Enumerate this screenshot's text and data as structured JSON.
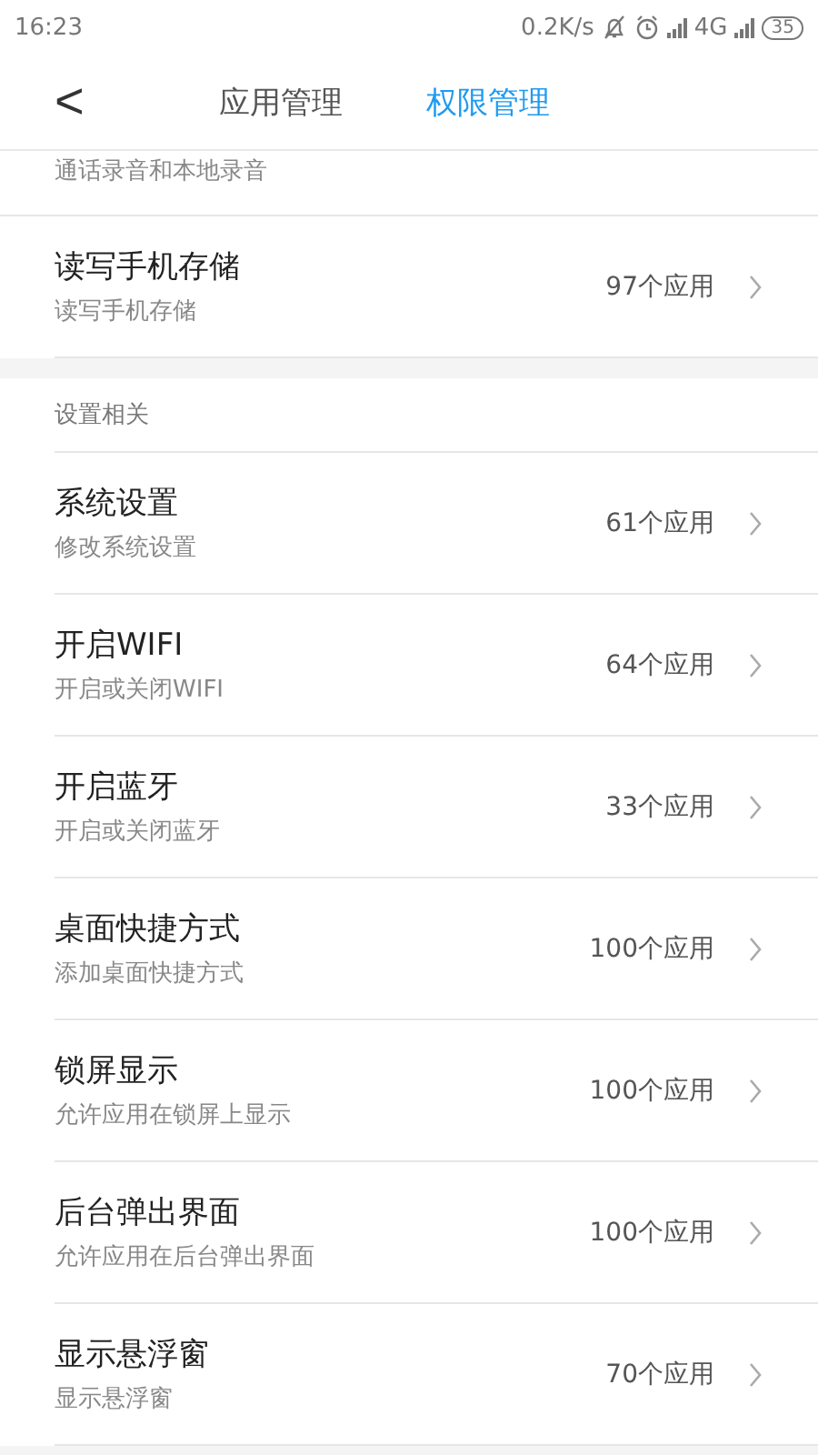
{
  "status_bar": {
    "time": "16:23",
    "speed": "0.2K/s",
    "network": "4G",
    "battery": "35"
  },
  "header": {
    "back": "<",
    "tabs": [
      {
        "label": "应用管理",
        "selected": false
      },
      {
        "label": "权限管理",
        "selected": true
      }
    ]
  },
  "partial_row": {
    "subtitle": "通话录音和本地录音"
  },
  "rows": [
    {
      "title": "读写手机存储",
      "subtitle": "读写手机存储",
      "count": "97个应用"
    }
  ],
  "sections": [
    {
      "title": "设置相关",
      "rows": [
        {
          "title": "系统设置",
          "subtitle": "修改系统设置",
          "count": "61个应用"
        },
        {
          "title": "开启WIFI",
          "subtitle": "开启或关闭WIFI",
          "count": "64个应用"
        },
        {
          "title": "开启蓝牙",
          "subtitle": "开启或关闭蓝牙",
          "count": "33个应用"
        },
        {
          "title": "桌面快捷方式",
          "subtitle": "添加桌面快捷方式",
          "count": "100个应用"
        },
        {
          "title": "锁屏显示",
          "subtitle": "允许应用在锁屏上显示",
          "count": "100个应用"
        },
        {
          "title": "后台弹出界面",
          "subtitle": "允许应用在后台弹出界面",
          "count": "100个应用"
        },
        {
          "title": "显示悬浮窗",
          "subtitle": "显示悬浮窗",
          "count": "70个应用"
        }
      ]
    }
  ]
}
